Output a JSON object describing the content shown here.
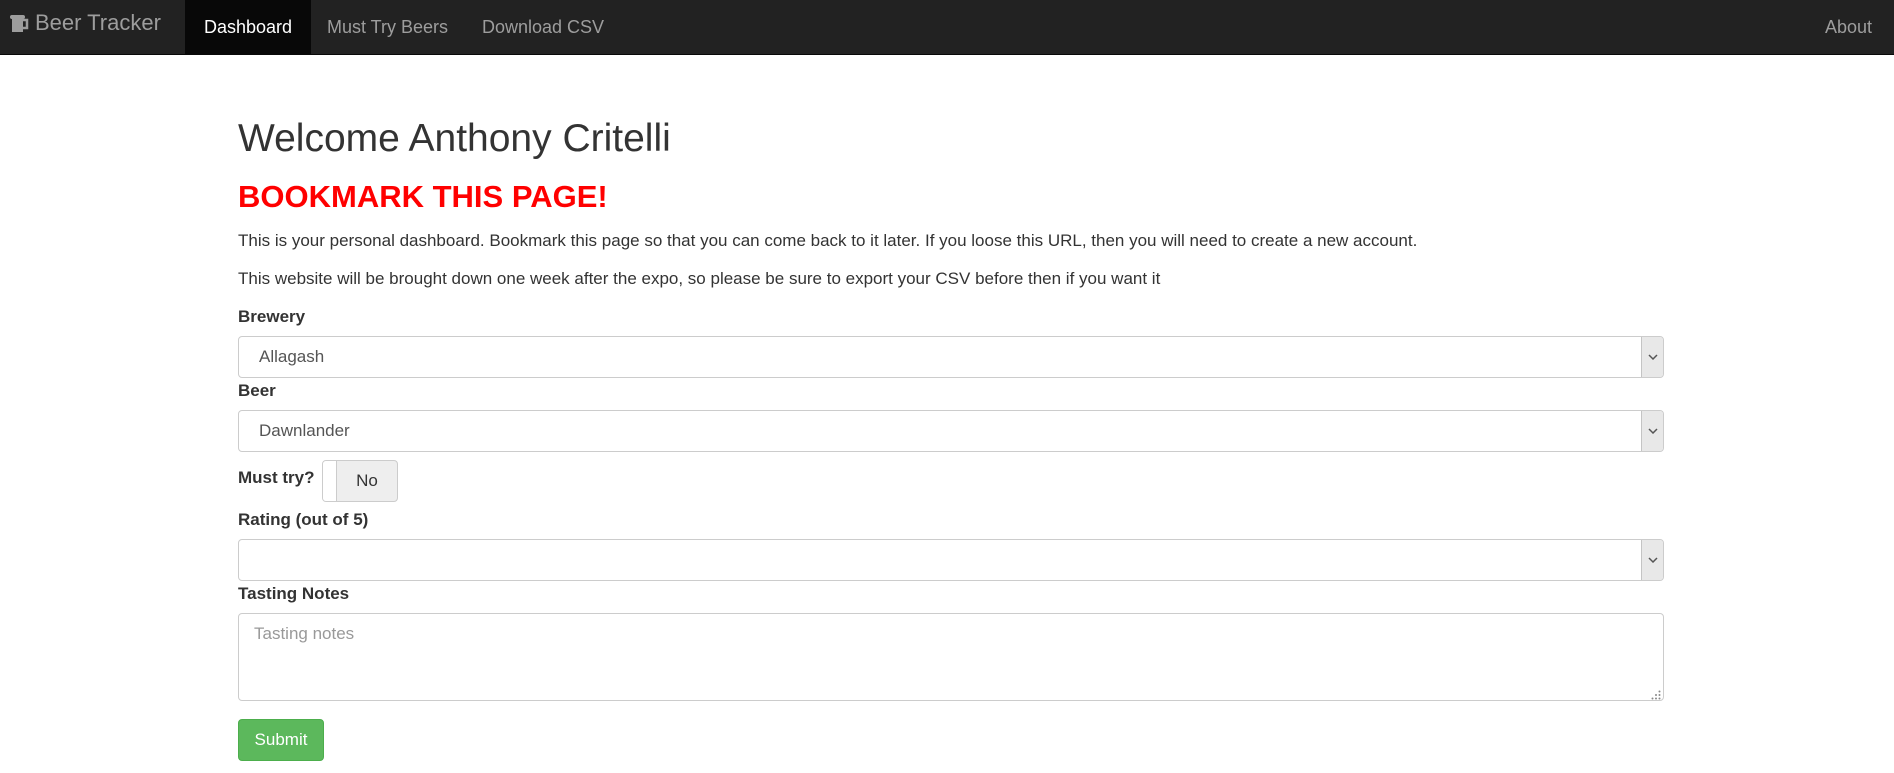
{
  "navbar": {
    "brand": "Beer Tracker",
    "brand_icon": "beer-mug-icon",
    "items": [
      {
        "label": "Dashboard",
        "active": true
      },
      {
        "label": "Must Try Beers",
        "active": false
      },
      {
        "label": "Download CSV",
        "active": false
      }
    ],
    "right_item": "About",
    "background": "#222222",
    "active_background": "#080808"
  },
  "page": {
    "title": "Welcome Anthony Critelli",
    "warning": "BOOKMARK THIS PAGE!",
    "warning_color": "#ff0000",
    "paragraphs": [
      "This is your personal dashboard. Bookmark this page so that you can come back to it later. If you loose this URL, then you will need to create a new account.",
      "This website will be brought down one week after the expo, so please be sure to export your CSV before then if you want it"
    ]
  },
  "form": {
    "brewery": {
      "label": "Brewery",
      "value": "Allagash"
    },
    "beer": {
      "label": "Beer",
      "value": "Dawnlander"
    },
    "must_try": {
      "label": "Must try?",
      "value": "No"
    },
    "rating": {
      "label": "Rating (out of 5)",
      "value": ""
    },
    "tasting_notes": {
      "label": "Tasting Notes",
      "placeholder": "Tasting notes",
      "value": ""
    },
    "submit_label": "Submit",
    "submit_color": "#5cb85c"
  }
}
